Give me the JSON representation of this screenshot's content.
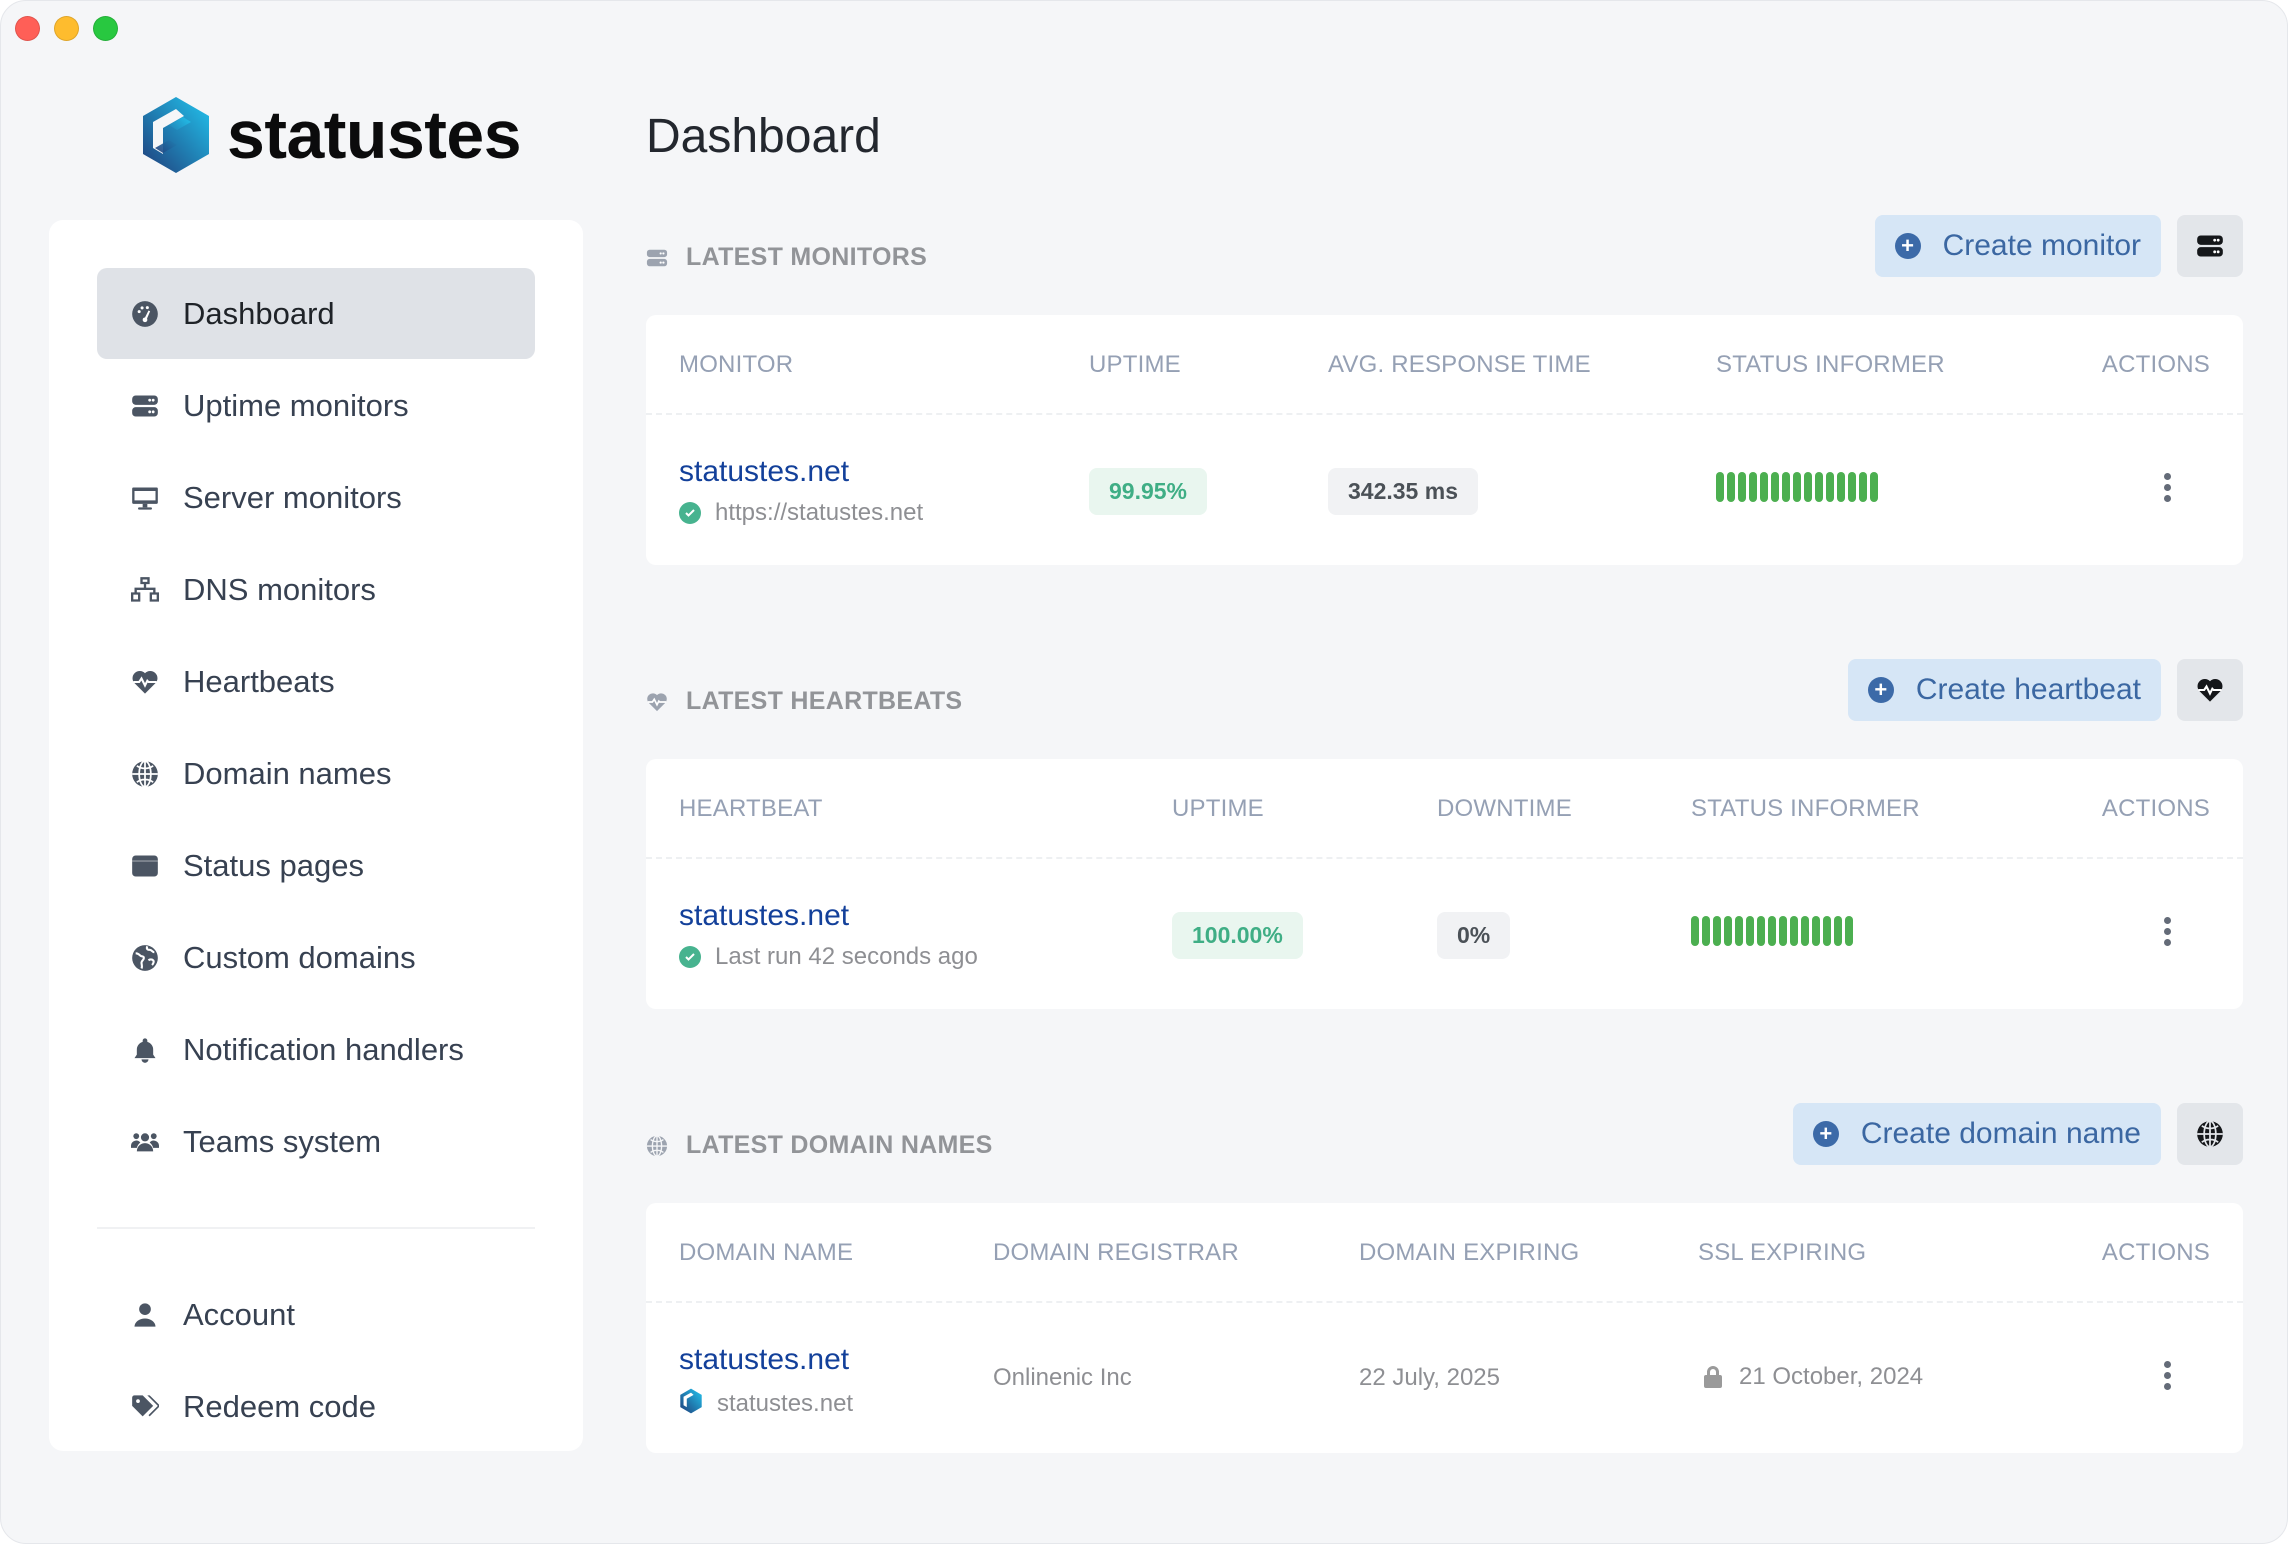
{
  "app": {
    "brand_name": "statustes",
    "brand_colors": {
      "logo_dark": "#1f3d7a",
      "logo_light": "#22c5ef"
    }
  },
  "sidebar": {
    "items": [
      {
        "label": "Dashboard",
        "icon": "gauge-icon",
        "active": true
      },
      {
        "label": "Uptime monitors",
        "icon": "server-icon"
      },
      {
        "label": "Server monitors",
        "icon": "desktop-icon"
      },
      {
        "label": "DNS monitors",
        "icon": "network-icon"
      },
      {
        "label": "Heartbeats",
        "icon": "heart-pulse-icon"
      },
      {
        "label": "Domain names",
        "icon": "globe-icon"
      },
      {
        "label": "Status pages",
        "icon": "window-icon"
      },
      {
        "label": "Custom domains",
        "icon": "earth-icon"
      },
      {
        "label": "Notification handlers",
        "icon": "bell-icon"
      },
      {
        "label": "Teams system",
        "icon": "users-icon"
      }
    ],
    "bottom_items": [
      {
        "label": "Account",
        "icon": "user-icon"
      },
      {
        "label": "Redeem code",
        "icon": "tags-icon"
      }
    ]
  },
  "page": {
    "title": "Dashboard"
  },
  "monitors": {
    "title": "LATEST MONITORS",
    "create_label": "Create monitor",
    "columns": [
      "MONITOR",
      "UPTIME",
      "AVG. RESPONSE TIME",
      "STATUS INFORMER",
      "ACTIONS"
    ],
    "rows": [
      {
        "name": "statustes.net",
        "url": "https://statustes.net",
        "uptime": "99.95%",
        "avg_response": "342.35 ms",
        "status_bars": [
          "up",
          "up",
          "up",
          "up",
          "up",
          "up",
          "up",
          "up",
          "up",
          "up",
          "up",
          "up",
          "up",
          "up",
          "up"
        ]
      }
    ]
  },
  "heartbeats": {
    "title": "LATEST HEARTBEATS",
    "create_label": "Create heartbeat",
    "columns": [
      "HEARTBEAT",
      "UPTIME",
      "DOWNTIME",
      "STATUS INFORMER",
      "ACTIONS"
    ],
    "rows": [
      {
        "name": "statustes.net",
        "last_run": "Last run 42 seconds ago",
        "uptime": "100.00%",
        "downtime": "0%",
        "status_bars": [
          "up",
          "up",
          "up",
          "up",
          "up",
          "up",
          "up",
          "up",
          "up",
          "up",
          "up",
          "up",
          "up",
          "up",
          "up"
        ]
      }
    ]
  },
  "domains": {
    "title": "LATEST DOMAIN NAMES",
    "create_label": "Create domain name",
    "columns": [
      "DOMAIN NAME",
      "DOMAIN REGISTRAR",
      "DOMAIN EXPIRING",
      "SSL EXPIRING",
      "ACTIONS"
    ],
    "rows": [
      {
        "name": "statustes.net",
        "sub": "statustes.net",
        "registrar": "Onlinenic Inc",
        "domain_expiring": "22 July, 2025",
        "ssl_expiring": "21 October, 2024"
      }
    ]
  },
  "colors": {
    "status_up": "#4caf50",
    "link": "#13409a",
    "uptime_badge_text": "#3fae85",
    "create_button_bg": "#d6e6f6"
  }
}
